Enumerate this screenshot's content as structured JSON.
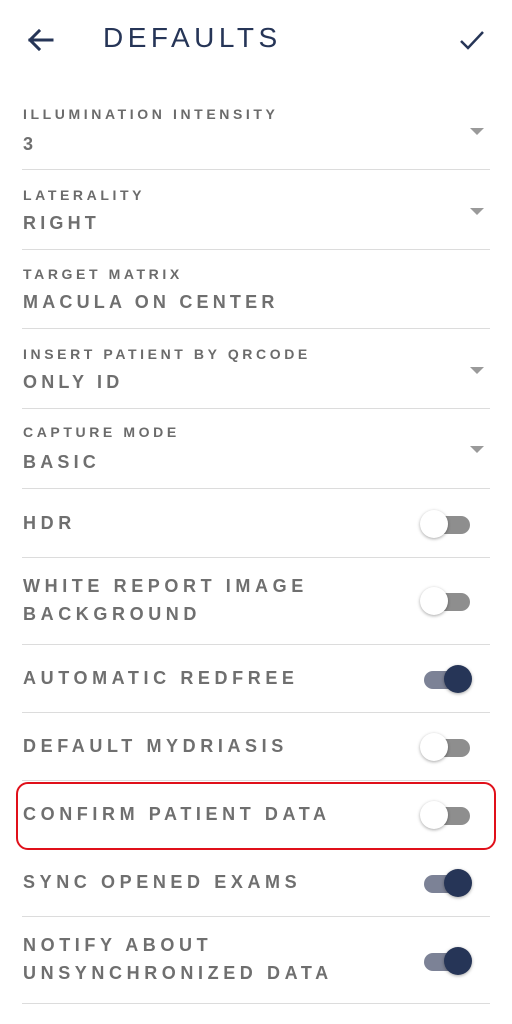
{
  "header": {
    "title": "DEFAULTS",
    "back_icon": "arrow-left-icon",
    "confirm_icon": "check-icon",
    "accent_color": "#263557"
  },
  "fields": [
    {
      "label": "ILLUMINATION INTENSITY",
      "value": "3",
      "dropdown": true
    },
    {
      "label": "LATERALITY",
      "value": "RIGHT",
      "dropdown": true
    },
    {
      "label": "TARGET MATRIX",
      "value": "MACULA ON CENTER",
      "dropdown": false
    },
    {
      "label": "INSERT PATIENT BY QRCODE",
      "value": "ONLY ID",
      "dropdown": true
    },
    {
      "label": "CAPTURE MODE",
      "value": "BASIC",
      "dropdown": true
    }
  ],
  "toggles": [
    {
      "label_lines": [
        "HDR"
      ],
      "on": false
    },
    {
      "label_lines": [
        "WHITE REPORT IMAGE",
        "BACKGROUND"
      ],
      "on": false
    },
    {
      "label_lines": [
        "AUTOMATIC REDFREE"
      ],
      "on": true
    },
    {
      "label_lines": [
        "DEFAULT MYDRIASIS"
      ],
      "on": false
    },
    {
      "label_lines": [
        "CONFIRM PATIENT DATA"
      ],
      "on": false,
      "highlighted": true
    },
    {
      "label_lines": [
        "SYNC OPENED EXAMS"
      ],
      "on": true
    },
    {
      "label_lines": [
        "NOTIFY ABOUT",
        "UNSYNCHRONIZED DATA"
      ],
      "on": true
    }
  ],
  "colors": {
    "toggle_on_thumb": "#263557",
    "toggle_on_track": "#7c8296",
    "toggle_off_track": "#8e8e8e",
    "highlight_border": "#e0101a"
  }
}
